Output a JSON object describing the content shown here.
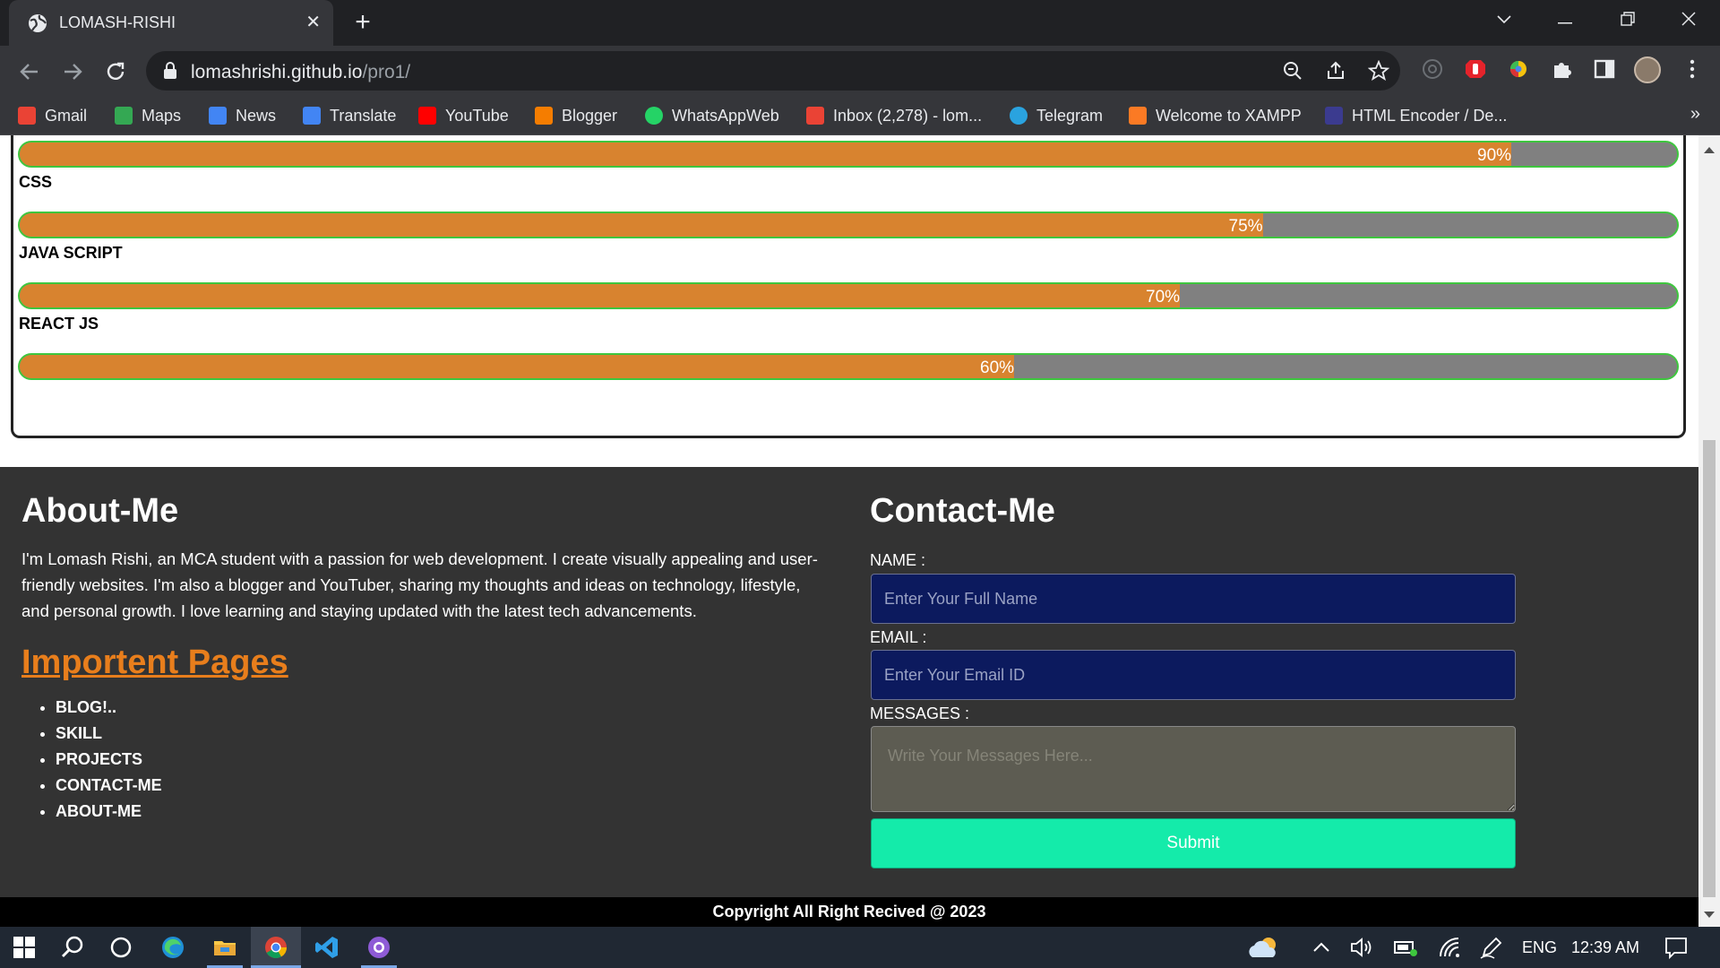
{
  "browser": {
    "tab_title": "LOMASH-RISHI",
    "tab_close": "✕",
    "new_tab": "+",
    "url_domain": "lomashrishi.github.io",
    "url_path": "/pro1/",
    "bookmarks": [
      {
        "label": "Gmail",
        "color": "#ea4335"
      },
      {
        "label": "Maps",
        "color": "#34a853"
      },
      {
        "label": "News",
        "color": "#4285f4"
      },
      {
        "label": "Translate",
        "color": "#4285f4"
      },
      {
        "label": "YouTube",
        "color": "#ff0000"
      },
      {
        "label": "Blogger",
        "color": "#f57d00"
      },
      {
        "label": "WhatsAppWeb",
        "color": "#25d366"
      },
      {
        "label": "Inbox (2,278) - lom...",
        "color": "#ea4335"
      },
      {
        "label": "Telegram",
        "color": "#2aa3df"
      },
      {
        "label": "Welcome to XAMPP",
        "color": "#fb7a24"
      },
      {
        "label": "HTML Encoder / De...",
        "color": "#3b3b8f"
      }
    ],
    "bookmarks_more": "»"
  },
  "skills": [
    {
      "label": "",
      "percent": 90,
      "percent_text": "90%"
    },
    {
      "label": "CSS",
      "percent": 75,
      "percent_text": "75%"
    },
    {
      "label": "JAVA SCRIPT",
      "percent": 70,
      "percent_text": "70%"
    },
    {
      "label": "REACT JS",
      "percent": 60,
      "percent_text": "60%"
    }
  ],
  "about": {
    "title": "About-Me",
    "text": "I'm Lomash Rishi, an MCA student with a passion for web development. I create visually appealing and user-friendly websites. I'm also a blogger and YouTuber, sharing my thoughts and ideas on technology, lifestyle, and personal growth. I love learning and staying updated with the latest tech advancements.",
    "pages_title": "Importent Pages",
    "pages": [
      "BLOG!..",
      "SKILL",
      "PROJECTS",
      "CONTACT-ME",
      "ABOUT-ME"
    ]
  },
  "contact": {
    "title": "Contact-Me",
    "name_label": "NAME :",
    "name_placeholder": "Enter Your Full Name",
    "email_label": "EMAIL :",
    "email_placeholder": "Enter Your Email ID",
    "messages_label": "MESSAGES :",
    "messages_placeholder": "Write Your Messages Here...",
    "submit_label": "Submit"
  },
  "footer": {
    "copyright": "Copyright All Right Recived @ 2023"
  },
  "taskbar": {
    "language": "ENG",
    "time": "12:39 AM"
  },
  "colors": {
    "skill_fill": "#d8832f",
    "skill_track": "#808080",
    "skill_border": "#3ec63e",
    "footer_bg": "#333333",
    "link_orange": "#e87e1c",
    "input_bg": "#0c1a5e",
    "submit_bg": "#14ebaa"
  }
}
